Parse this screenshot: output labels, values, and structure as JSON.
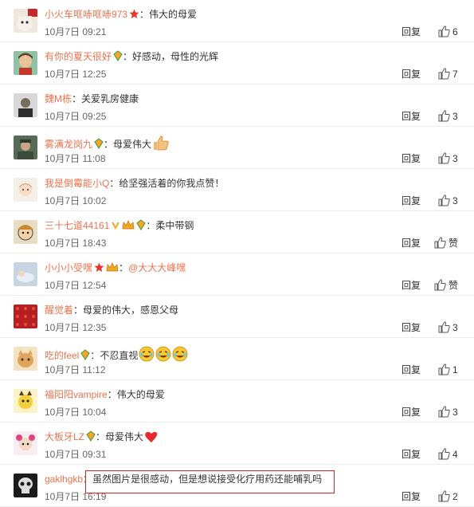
{
  "accent": "#eb7350",
  "comments": [
    {
      "user": "小火车哐哧哐哧973",
      "badge": "star",
      "text": "伟大的母爱",
      "mention": "",
      "emoji": "",
      "time": "10月7日 09:21",
      "reply": "回复",
      "likes": "6",
      "avatar": "cat-avatar"
    },
    {
      "user": "有你的夏天很好",
      "badge": "vip-gem",
      "text": "好感动，母性的光辉",
      "mention": "",
      "emoji": "",
      "time": "10月7日 12:25",
      "reply": "回复",
      "likes": "7",
      "avatar": "illustrated-face-avatar"
    },
    {
      "user": "魏M栋",
      "badge": "",
      "text": "关爱乳房健康",
      "mention": "",
      "emoji": "",
      "time": "10月7日 09:25",
      "reply": "回复",
      "likes": "3",
      "avatar": "portrait-avatar"
    },
    {
      "user": "雾满龙岗九",
      "badge": "vip-gem",
      "text": "母爱伟大",
      "mention": "",
      "emoji": "thumbs-up",
      "time": "10月7日 11:08",
      "reply": "回复",
      "likes": "3",
      "avatar": "military-avatar"
    },
    {
      "user": "我是倒霉能小Q",
      "badge": "",
      "text": "给坚强活着的你我点赞！",
      "mention": "",
      "emoji": "",
      "time": "10月7日 10:02",
      "reply": "回复",
      "likes": "3",
      "avatar": "anime-girl-avatar"
    },
    {
      "user": "三十七道44161",
      "badge": "v-crown-gem",
      "text": "柔中带钢",
      "mention": "",
      "emoji": "",
      "time": "10月7日 18:43",
      "reply": "回复",
      "likes": "赞",
      "avatar": "cartoon-face-avatar"
    },
    {
      "user": "小小小受嘿",
      "badge": "star-crown",
      "text": "",
      "mention": "@大大大峰嘿",
      "emoji": "",
      "time": "10月7日 12:54",
      "reply": "回复",
      "likes": "赞",
      "avatar": "sleeping-figure-avatar"
    },
    {
      "user": "醒觉着",
      "badge": "",
      "text": "母爱的伟大，感恩父母",
      "mention": "",
      "emoji": "",
      "time": "10月7日 12:35",
      "reply": "回复",
      "likes": "3",
      "avatar": "red-pattern-avatar"
    },
    {
      "user": "吃的feel",
      "badge": "vip-gem",
      "text": "不忍直视",
      "mention": "",
      "emoji": "laugh-cry-x3",
      "time": "10月7日 11:12",
      "reply": "回复",
      "likes": "1",
      "avatar": "cat-face-avatar"
    },
    {
      "user": "福阳阳vampire",
      "badge": "",
      "text": "伟大的母爱",
      "mention": "",
      "emoji": "",
      "time": "10月7日 10:04",
      "reply": "回复",
      "likes": "3",
      "avatar": "yellow-character-avatar"
    },
    {
      "user": "大板牙LZ",
      "badge": "vip-gem",
      "text": "母爱伟大",
      "mention": "",
      "emoji": "red-heart",
      "time": "10月7日 09:31",
      "reply": "回复",
      "likes": "4",
      "avatar": "doll-avatar"
    },
    {
      "user": "gaklhgkb",
      "badge": "",
      "text": "虽然图片是很感动，但是想说接受化疗用药还能哺乳吗",
      "mention": "",
      "emoji": "",
      "time": "10月7日 16:19",
      "reply": "回复",
      "likes": "2",
      "avatar": "skull-avatar"
    }
  ]
}
